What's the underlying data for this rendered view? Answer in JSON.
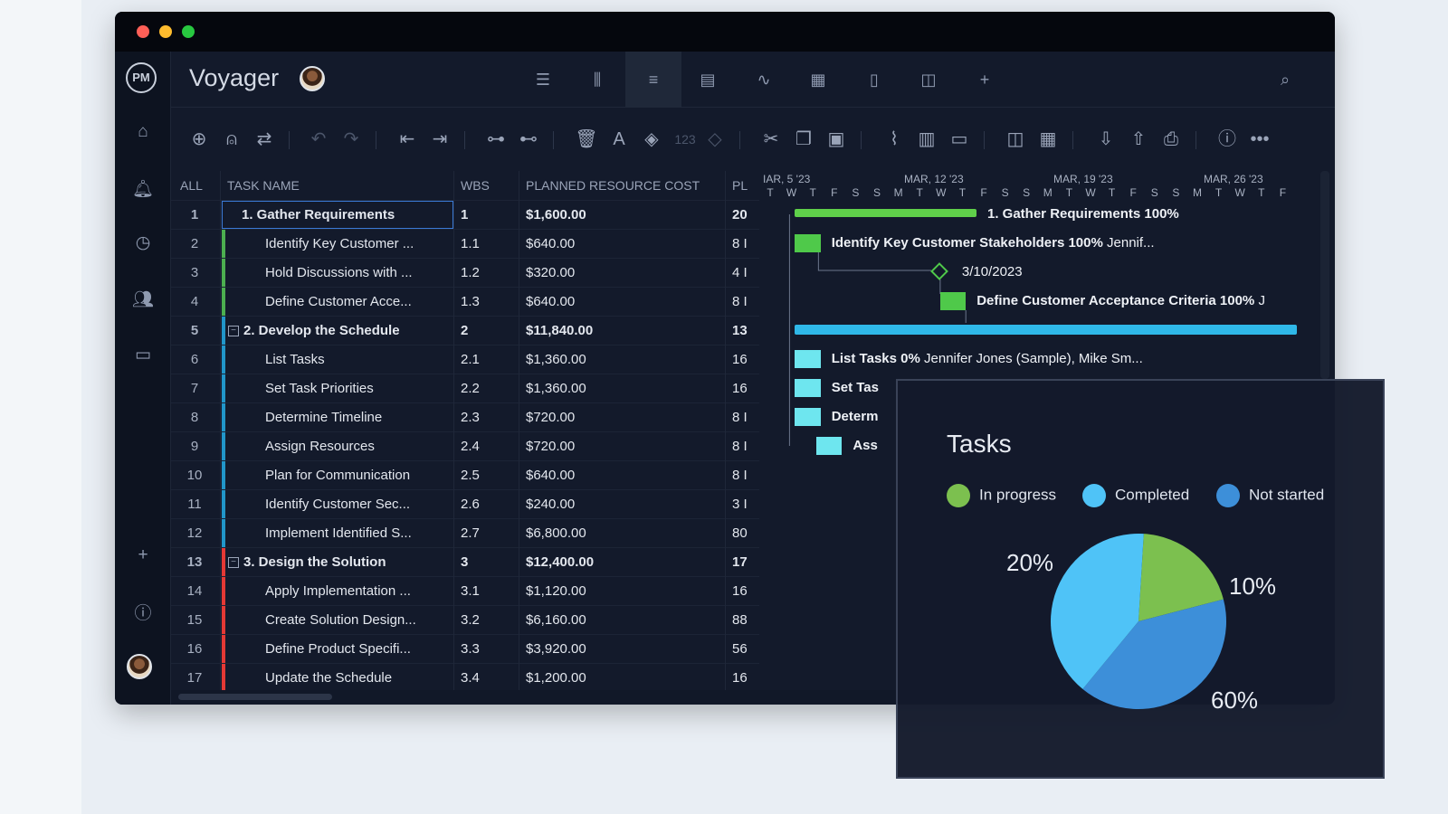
{
  "app": {
    "title": "Voyager",
    "logo": "PM"
  },
  "window_controls": [
    "close",
    "minimize",
    "maximize"
  ],
  "sidebar": {
    "icons": [
      "home-icon",
      "bell-icon",
      "clock-icon",
      "users-icon",
      "briefcase-icon",
      "plus-icon",
      "help-icon"
    ]
  },
  "top_nav": {
    "icons": [
      "list-view-icon",
      "board-view-icon",
      "gantt-view-icon",
      "sheet-view-icon",
      "dashboard-icon",
      "calendar-icon",
      "document-icon",
      "split-view-icon",
      "add-view-icon"
    ],
    "active": "gantt-view-icon"
  },
  "toolbar": {
    "number_label": "123"
  },
  "grid": {
    "headers": {
      "all": "ALL",
      "task_name": "TASK NAME",
      "wbs": "WBS",
      "cost": "PLANNED RESOURCE COST",
      "pl": "PL"
    },
    "rows": [
      {
        "num": "1",
        "name": "1. Gather Requirements",
        "wbs": "1",
        "cost": "$1,600.00",
        "pl": "20",
        "bold": true,
        "indent": 0,
        "color": "",
        "collapse": false
      },
      {
        "num": "2",
        "name": "Identify Key Customer ...",
        "wbs": "1.1",
        "cost": "$640.00",
        "pl": "8 I",
        "bold": false,
        "indent": 1,
        "color": "#4caf50",
        "collapse": false
      },
      {
        "num": "3",
        "name": "Hold Discussions with ...",
        "wbs": "1.2",
        "cost": "$320.00",
        "pl": "4 I",
        "bold": false,
        "indent": 1,
        "color": "#4caf50",
        "collapse": false
      },
      {
        "num": "4",
        "name": "Define Customer Acce...",
        "wbs": "1.3",
        "cost": "$640.00",
        "pl": "8 I",
        "bold": false,
        "indent": 1,
        "color": "#4caf50",
        "collapse": false
      },
      {
        "num": "5",
        "name": "2. Develop the Schedule",
        "wbs": "2",
        "cost": "$11,840.00",
        "pl": "13",
        "bold": true,
        "indent": 0,
        "color": "#2196c9",
        "collapse": true
      },
      {
        "num": "6",
        "name": "List Tasks",
        "wbs": "2.1",
        "cost": "$1,360.00",
        "pl": "16",
        "bold": false,
        "indent": 1,
        "color": "#2196c9",
        "collapse": false
      },
      {
        "num": "7",
        "name": "Set Task Priorities",
        "wbs": "2.2",
        "cost": "$1,360.00",
        "pl": "16",
        "bold": false,
        "indent": 1,
        "color": "#2196c9",
        "collapse": false
      },
      {
        "num": "8",
        "name": "Determine Timeline",
        "wbs": "2.3",
        "cost": "$720.00",
        "pl": "8 I",
        "bold": false,
        "indent": 1,
        "color": "#2196c9",
        "collapse": false
      },
      {
        "num": "9",
        "name": "Assign Resources",
        "wbs": "2.4",
        "cost": "$720.00",
        "pl": "8 I",
        "bold": false,
        "indent": 1,
        "color": "#2196c9",
        "collapse": false
      },
      {
        "num": "10",
        "name": "Plan for Communication",
        "wbs": "2.5",
        "cost": "$640.00",
        "pl": "8 I",
        "bold": false,
        "indent": 1,
        "color": "#2196c9",
        "collapse": false
      },
      {
        "num": "11",
        "name": "Identify Customer Sec...",
        "wbs": "2.6",
        "cost": "$240.00",
        "pl": "3 I",
        "bold": false,
        "indent": 1,
        "color": "#2196c9",
        "collapse": false
      },
      {
        "num": "12",
        "name": "Implement Identified S...",
        "wbs": "2.7",
        "cost": "$6,800.00",
        "pl": "80",
        "bold": false,
        "indent": 1,
        "color": "#2196c9",
        "collapse": false
      },
      {
        "num": "13",
        "name": "3. Design the Solution",
        "wbs": "3",
        "cost": "$12,400.00",
        "pl": "17",
        "bold": true,
        "indent": 0,
        "color": "#e53935",
        "collapse": true
      },
      {
        "num": "14",
        "name": "Apply Implementation ...",
        "wbs": "3.1",
        "cost": "$1,120.00",
        "pl": "16",
        "bold": false,
        "indent": 1,
        "color": "#e53935",
        "collapse": false
      },
      {
        "num": "15",
        "name": "Create Solution Design...",
        "wbs": "3.2",
        "cost": "$6,160.00",
        "pl": "88",
        "bold": false,
        "indent": 1,
        "color": "#e53935",
        "collapse": false
      },
      {
        "num": "16",
        "name": "Define Product Specifi...",
        "wbs": "3.3",
        "cost": "$3,920.00",
        "pl": "56",
        "bold": false,
        "indent": 1,
        "color": "#e53935",
        "collapse": false
      },
      {
        "num": "17",
        "name": "Update the Schedule",
        "wbs": "3.4",
        "cost": "$1,200.00",
        "pl": "16",
        "bold": false,
        "indent": 1,
        "color": "#e53935",
        "collapse": false
      }
    ]
  },
  "gantt": {
    "weeks": [
      "IAR, 5 '23",
      "MAR, 12 '23",
      "MAR, 19 '23",
      "MAR, 26 '23"
    ],
    "days": [
      "T",
      "W",
      "T",
      "F",
      "S",
      "S",
      "M",
      "T",
      "W",
      "T",
      "F",
      "S",
      "S",
      "M",
      "T",
      "W",
      "T",
      "F",
      "S",
      "S",
      "M",
      "T",
      "W",
      "T",
      "F"
    ],
    "tasks": [
      {
        "row": 0,
        "type": "summary",
        "start": 1.5,
        "end": 10,
        "color": "#5fd04a",
        "label": "1. Gather Requirements",
        "pct": "100%",
        "res": ""
      },
      {
        "row": 1,
        "type": "task",
        "start": 1.5,
        "end": 2.7,
        "color": "#4fc94a",
        "label": "Identify Key Customer Stakeholders",
        "pct": "100%",
        "res": "Jennif..."
      },
      {
        "row": 2,
        "type": "milestone",
        "start": 8.3,
        "end": 8.3,
        "color": "#4fc94a",
        "label": "3/10/2023",
        "pct": "",
        "res": ""
      },
      {
        "row": 3,
        "type": "task",
        "start": 8.3,
        "end": 9.5,
        "color": "#4fc94a",
        "label": "Define Customer Acceptance Criteria",
        "pct": "100%",
        "res": "J"
      },
      {
        "row": 4,
        "type": "summary",
        "start": 1.5,
        "end": 25,
        "color": "#2fb8e8",
        "label": "",
        "pct": "",
        "res": ""
      },
      {
        "row": 5,
        "type": "task",
        "start": 1.5,
        "end": 2.7,
        "color": "#6ee6ef",
        "label": "List Tasks",
        "pct": "0%",
        "res": "Jennifer Jones (Sample), Mike Sm..."
      },
      {
        "row": 6,
        "type": "task",
        "start": 1.5,
        "end": 2.7,
        "color": "#6ee6ef",
        "label": "Set Tas",
        "pct": "",
        "res": ""
      },
      {
        "row": 7,
        "type": "task",
        "start": 1.5,
        "end": 2.7,
        "color": "#6ee6ef",
        "label": "Determ",
        "pct": "",
        "res": ""
      },
      {
        "row": 8,
        "type": "task",
        "start": 2.5,
        "end": 3.7,
        "color": "#6ee6ef",
        "label": "Ass",
        "pct": "",
        "res": ""
      }
    ]
  },
  "popup": {
    "title": "Tasks",
    "legend": [
      {
        "label": "In progress",
        "color": "#7cc04f"
      },
      {
        "label": "Completed",
        "color": "#4fc3f7"
      },
      {
        "label": "Not started",
        "color": "#3d8fd9"
      }
    ],
    "chart_data": {
      "type": "pie",
      "title": "Tasks",
      "slices": [
        {
          "label": "In progress",
          "value": 20,
          "color": "#7cc04f"
        },
        {
          "label": "Not started",
          "value": 40,
          "color": "#3d8fd9"
        },
        {
          "label": "Completed",
          "value": 40,
          "color": "#4fc3f7"
        }
      ],
      "printed_labels": [
        "20%",
        "10%",
        "60%"
      ]
    }
  }
}
